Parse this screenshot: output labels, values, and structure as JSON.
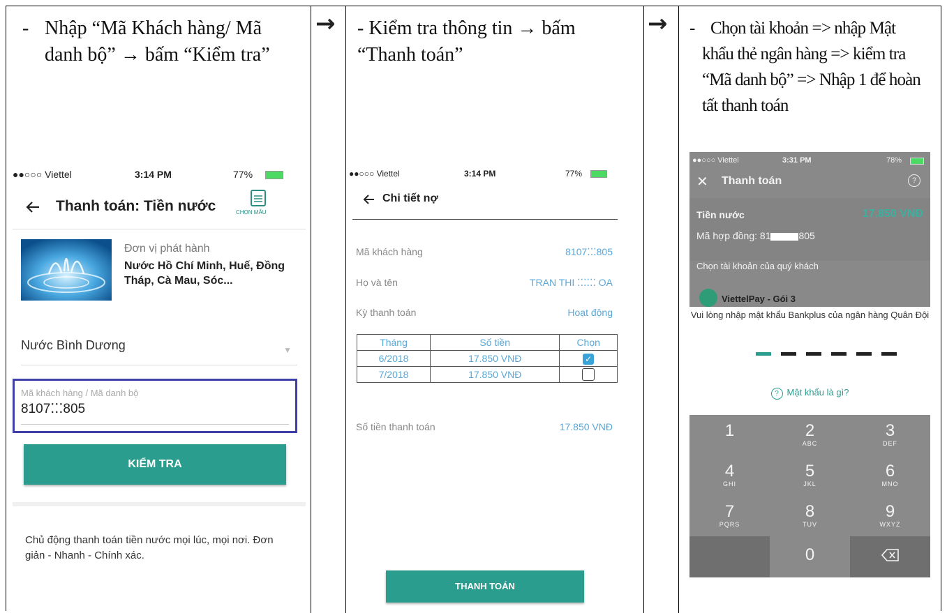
{
  "steps": [
    {
      "dash": "-",
      "text": "Nhập “Mã Khách hàng/ Mã danh bộ” → bấm “Kiểm tra”"
    },
    {
      "dash": "",
      "text": "- Kiểm tra thông tin → bấm “Thanh toán”"
    },
    {
      "dash": "-",
      "text": "Chọn tài khoản => nhập Mật khẩu thẻ ngân hàng => kiểm tra “Mã danh bộ” => Nhập 1 để hoàn tất thanh toán"
    }
  ],
  "arrow": "→",
  "screen1": {
    "status": {
      "carrier": "●●○○○ Viettel",
      "time": "3:14 PM",
      "battery": "77%"
    },
    "title": "Thanh toán: Tiền nước",
    "template_label": "CHỌN MẪU",
    "issuer_label": "Đơn vị phát hành",
    "issuer_name": "Nước Hồ Chí Minh, Huế, Đồng Tháp, Cà Mau, Sóc...",
    "provider_select": "Nước Bình Dương",
    "field_label": "Mã khách hàng / Mã danh bộ",
    "field_value": "8107⁚⁚⁚805",
    "check_button": "KIỂM TRA",
    "description": "Chủ động thanh toán tiền nước mọi lúc, mọi nơi. Đơn giản - Nhanh - Chính xác."
  },
  "screen2": {
    "status": {
      "carrier": "●●○○○ Viettel",
      "time": "3:14 PM",
      "battery": "77%"
    },
    "title": "Chi tiết nợ",
    "rows": [
      {
        "label": "Mã khách hàng",
        "value": "8107⁚⁚⁚805"
      },
      {
        "label": "Họ và tên",
        "value": "TRAN THI ⁚⁚⁚⁚⁚⁚ OA"
      },
      {
        "label": "Kỳ thanh toán",
        "value": "Hoạt động"
      }
    ],
    "table": {
      "headers": [
        "Tháng",
        "Số tiền",
        "Chọn"
      ],
      "rows": [
        {
          "month": "6/2018",
          "amount": "17.850 VNĐ",
          "selected": true
        },
        {
          "month": "7/2018",
          "amount": "17.850 VNĐ",
          "selected": false
        }
      ]
    },
    "total_label": "Số tiền thanh toán",
    "total_value": "17.850 VNĐ",
    "pay_button": "THANH TOÁN"
  },
  "screen3": {
    "status": {
      "carrier": "●●○○○ Viettel",
      "time": "3:31 PM",
      "battery": "78%"
    },
    "title": "Thanh toán",
    "bill_name": "Tiền nước",
    "bill_amount": "17.850 VNĐ",
    "contract_label": "Mã hợp đồng: 81",
    "contract_suffix": "805",
    "choose_account": "Chọn tài khoản của quý khách",
    "account": "ViettelPay - Gói 3",
    "prompt": "Vui lòng nhập mật khẩu Bankplus của ngân hàng Quân Đội",
    "help": "Mật khẩu là gì?",
    "keys": [
      {
        "n": "1",
        "l": ""
      },
      {
        "n": "2",
        "l": "ABC"
      },
      {
        "n": "3",
        "l": "DEF"
      },
      {
        "n": "4",
        "l": "GHI"
      },
      {
        "n": "5",
        "l": "JKL"
      },
      {
        "n": "6",
        "l": "MNO"
      },
      {
        "n": "7",
        "l": "PQRS"
      },
      {
        "n": "8",
        "l": "TUV"
      },
      {
        "n": "9",
        "l": "WXYZ"
      },
      {
        "n": "0",
        "l": ""
      }
    ]
  }
}
